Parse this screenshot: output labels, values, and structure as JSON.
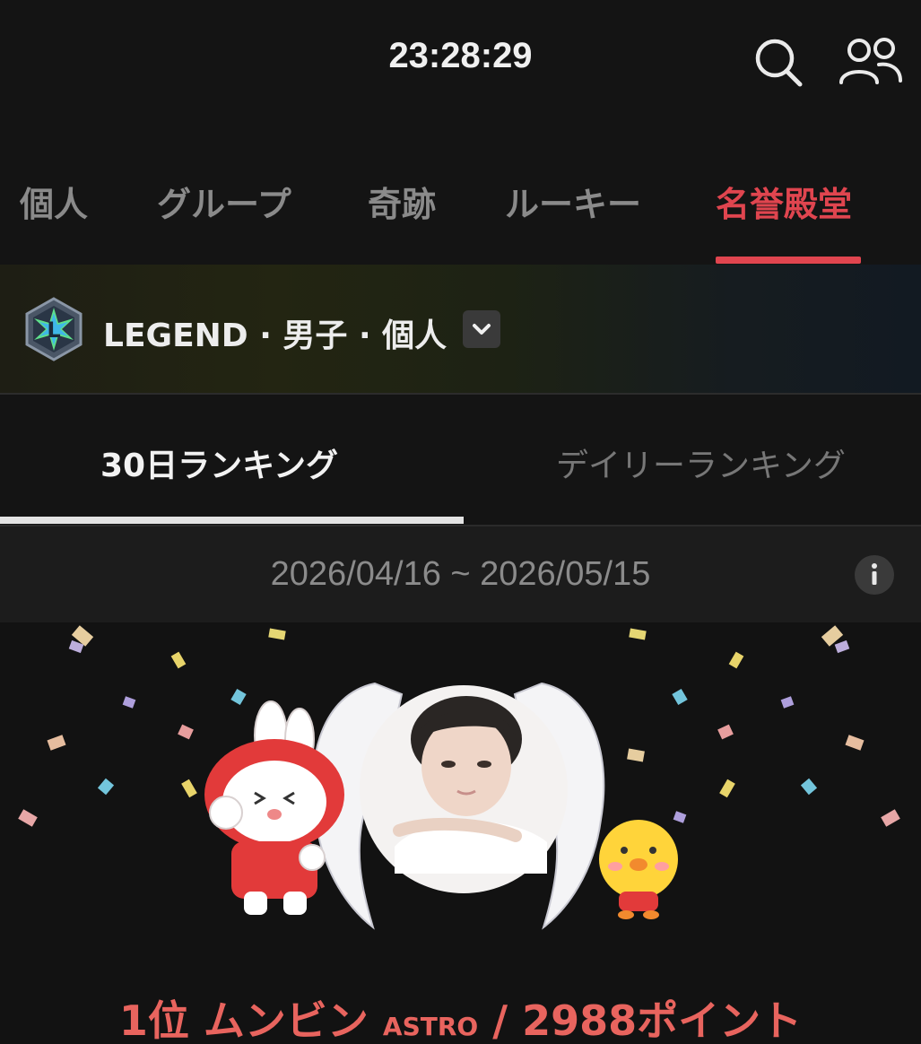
{
  "header": {
    "clock": "23:28:29"
  },
  "icons": {
    "search": "search-icon",
    "people": "people-icon",
    "dropdown": "chevron-down-icon",
    "info": "info-icon"
  },
  "tabs": [
    {
      "label": "個人",
      "active": false
    },
    {
      "label": "グループ",
      "active": false
    },
    {
      "label": "奇跡",
      "active": false
    },
    {
      "label": "ルーキー",
      "active": false
    },
    {
      "label": "名誉殿堂",
      "active": true
    }
  ],
  "category": {
    "badge_letter": "L",
    "title": "LEGEND · 男子 · 個人"
  },
  "subtabs": [
    {
      "label": "30日ランキング",
      "active": true
    },
    {
      "label": "デイリーランキング",
      "active": false
    }
  ],
  "period": {
    "range": "2026/04/16 ~ 2026/05/15"
  },
  "winner": {
    "rank": "1位",
    "name": "ムンビン",
    "group": "ASTRO",
    "separator": "/",
    "points": "2988ポイント"
  },
  "colors": {
    "accent": "#e0454f",
    "rank_text": "#e8645e",
    "background": "#141414"
  }
}
